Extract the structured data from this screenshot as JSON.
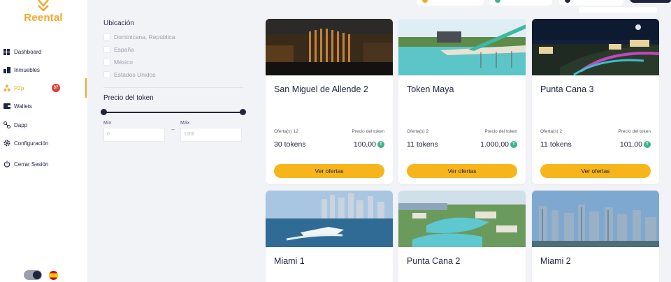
{
  "app": {
    "logo_text": "Reental",
    "accent": "#f0a72a",
    "dark": "#1f2440"
  },
  "sidebar": {
    "items": [
      {
        "label": "Dashboard",
        "icon": "grid-icon"
      },
      {
        "label": "Inmuebles",
        "icon": "building-icon"
      },
      {
        "label": "P2p",
        "icon": "network-icon",
        "badge": "37",
        "active": true
      },
      {
        "label": "Wallets",
        "icon": "wallet-icon"
      },
      {
        "label": "Dapp",
        "icon": "dapp-icon"
      },
      {
        "label": "Configuración",
        "icon": "gear-icon"
      },
      {
        "label": "Cerrar Sesión",
        "icon": "power-icon"
      }
    ]
  },
  "filters": {
    "location_title": "Ubicación",
    "locations": [
      "Dominicana, República",
      "España",
      "México",
      "Estados Unidos"
    ],
    "price_title": "Precio del token",
    "min_label": "Min",
    "max_label": "Máx",
    "min_placeholder": "0",
    "max_placeholder": "1000"
  },
  "cards": [
    {
      "title": "San Miguel de Allende 2",
      "offers_label": "Oferta(s)",
      "offers_count": "12",
      "price_label": "Precio del token",
      "tokens": "30 tokens",
      "price": "100,00",
      "button": "Ver ofertas"
    },
    {
      "title": "Token Maya",
      "offers_label": "Oferta(s)",
      "offers_count": "2",
      "price_label": "Precio del token",
      "tokens": "11 tokens",
      "price": "1.000,00",
      "button": "Ver ofertas"
    },
    {
      "title": "Punta Cana 3",
      "offers_label": "Oferta(s)",
      "offers_count": "2",
      "price_label": "Precio del token",
      "tokens": "11 tokens",
      "price": "101,00",
      "button": "Ver ofertas"
    },
    {
      "title": "Miami 1"
    },
    {
      "title": "Punta Cana 2"
    },
    {
      "title": "Miami 2"
    }
  ]
}
